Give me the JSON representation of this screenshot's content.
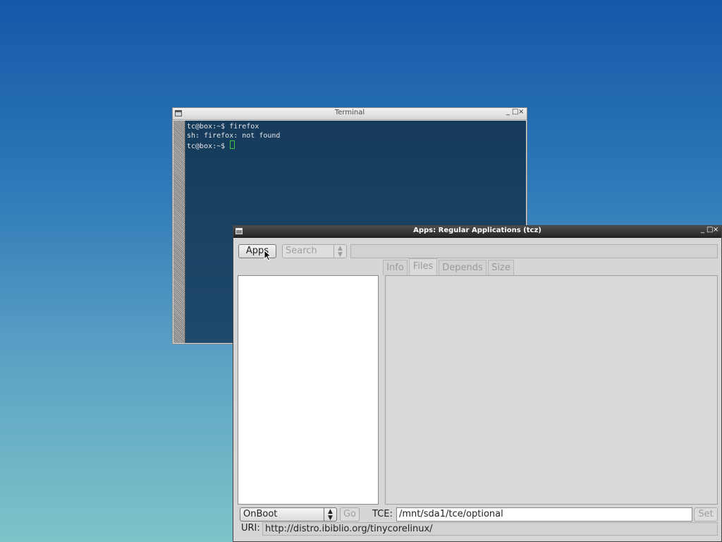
{
  "terminal": {
    "title": "Terminal",
    "lines": [
      "tc@box:~$ firefox",
      "sh: firefox: not found",
      "tc@box:~$ "
    ],
    "controls": [
      "_",
      "□",
      "×"
    ]
  },
  "apps_window": {
    "title": "Apps: Regular Applications (tcz)",
    "controls": [
      "_",
      "□",
      "×"
    ],
    "apps_button": "Apps",
    "search_select": "Search",
    "search_input_value": "",
    "tabs": [
      "Info",
      "Files",
      "Depends",
      "Size"
    ],
    "selected_tab": "Files",
    "onboot_select": "OnBoot",
    "go_button": "Go",
    "tce_label": "TCE:",
    "tce_value": "/mnt/sda1/tce/optional",
    "set_button": "Set",
    "uri_label": "URI:",
    "uri_value": "http://distro.ibiblio.org/tinycorelinux/"
  },
  "colors": {
    "desktop_top": "#1458a8",
    "desktop_bottom": "#7cc4c8",
    "terminal_bg": "#1a4264",
    "cursor": "#3ec43e"
  },
  "icons": {
    "window_menu": "window-menu-icon",
    "minimize": "minimize-icon",
    "maximize": "maximize-icon",
    "close": "close-icon",
    "mouse_pointer": "mouse-pointer-icon"
  }
}
